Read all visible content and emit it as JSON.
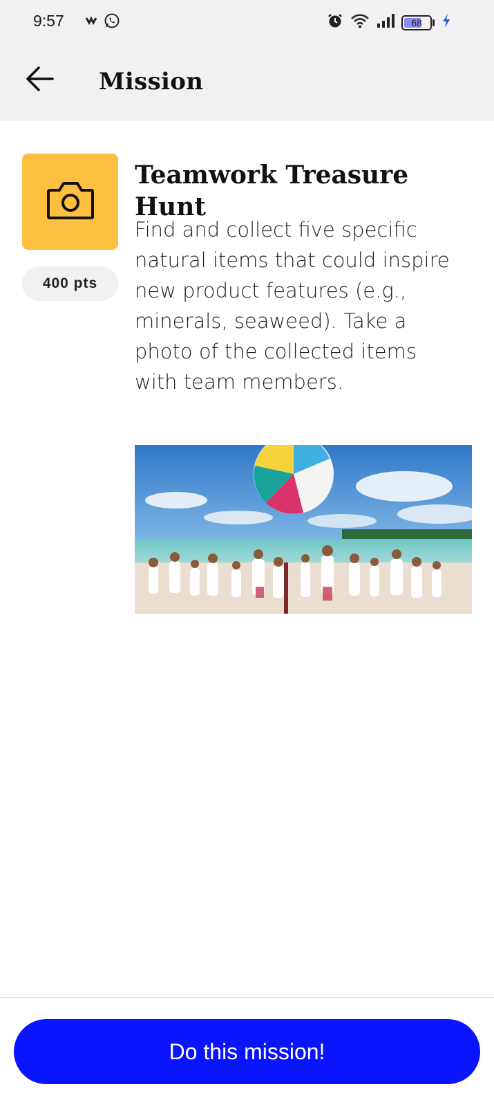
{
  "status_bar": {
    "time": "9:57",
    "battery_level": "68",
    "battery_fraction": 0.68
  },
  "app_bar": {
    "title": "Mission",
    "back_icon": "arrow-left-icon"
  },
  "mission": {
    "icon": "camera-icon",
    "icon_bg_color": "#fdbf3f",
    "points": "400 pts",
    "title": "Teamwork Treasure Hunt",
    "description": "Find and collect five specific natural items that could inspire new product features (e.g., minerals, seaweed). Take a photo of the collected items with team members."
  },
  "cta": {
    "label": "Do this mission!",
    "color": "#0a14ff"
  }
}
